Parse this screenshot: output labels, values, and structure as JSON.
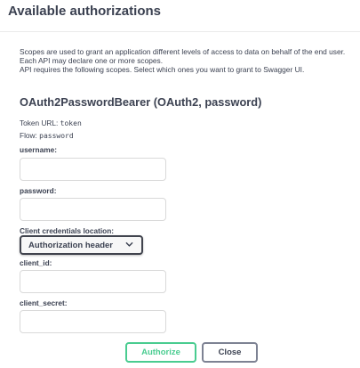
{
  "modal": {
    "title": "Available authorizations"
  },
  "description": {
    "line1": "Scopes are used to grant an application different levels of access to data on behalf of the end user.",
    "line2": "Each API may declare one or more scopes.",
    "line3": "API requires the following scopes. Select which ones you want to grant to Swagger UI."
  },
  "scheme": {
    "title": "OAuth2PasswordBearer (OAuth2, password)",
    "token_url_label": "Token URL:",
    "token_url_value": "token",
    "flow_label": "Flow:",
    "flow_value": "password"
  },
  "form": {
    "username_label": "username:",
    "username_value": "",
    "password_label": "password:",
    "password_value": "",
    "credentials_location_label": "Client credentials location:",
    "credentials_location_value": "Authorization header",
    "client_id_label": "client_id:",
    "client_id_value": "",
    "client_secret_label": "client_secret:",
    "client_secret_value": ""
  },
  "buttons": {
    "authorize": "Authorize",
    "close": "Close"
  },
  "colors": {
    "accent_green": "#49cc90",
    "text": "#3b4151",
    "select_border": "#41444e"
  }
}
